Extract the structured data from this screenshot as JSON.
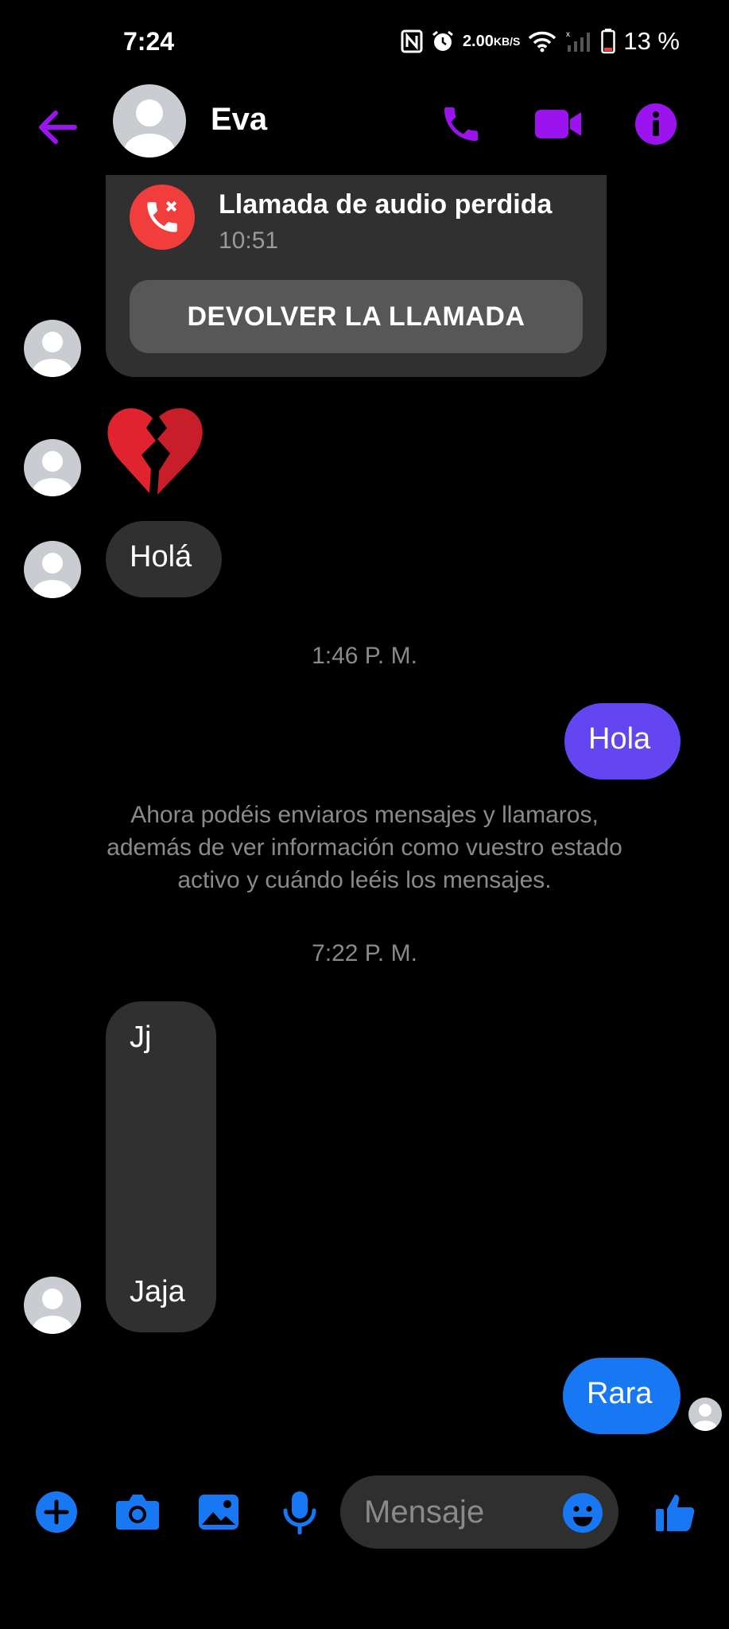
{
  "status_bar": {
    "time": "7:24",
    "net_speed": "2.00",
    "net_unit": "KB/S",
    "battery": "13 %"
  },
  "header": {
    "contact_name": "Eva",
    "icons": [
      "back-arrow-icon",
      "phone-icon",
      "video-camera-icon",
      "info-icon"
    ],
    "accent_color": "#9b14f0"
  },
  "call_card": {
    "title": "Llamada de audio perdida",
    "time": "10:51",
    "button_label": "DEVOLVER LA LLAMADA"
  },
  "messages": {
    "emoji": "broken-heart",
    "hola_in": "Holá",
    "ts1": "1:46 P. M.",
    "hola_out": "Hola",
    "info": "Ahora podéis enviaros mensajes y llamaros, además de ver información como vuestro estado activo y cuándo leéis los mensajes.",
    "ts2": "7:22 P. M.",
    "jj": "Jj",
    "jaja": "Jaja",
    "rara": "Rara"
  },
  "colors": {
    "outgoing_purple": "#6445f2",
    "outgoing_blue": "#1877f2",
    "incoming_bubble": "#303030",
    "missed_call_red": "#f23d3d",
    "composer_blue": "#1877f2"
  },
  "composer": {
    "placeholder": "Mensaje",
    "icons": [
      "plus-icon",
      "camera-icon",
      "image-icon",
      "microphone-icon",
      "emoji-icon",
      "thumbs-up-icon"
    ]
  }
}
